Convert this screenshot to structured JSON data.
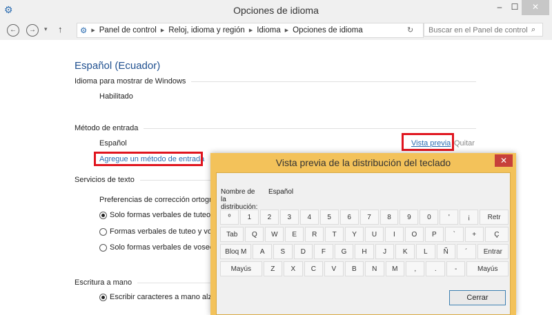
{
  "window": {
    "title": "Opciones de idioma",
    "minimize": "‒",
    "maximize": "☐",
    "close": "✕"
  },
  "nav": {
    "back": "←",
    "forward": "→",
    "dropdown": "▾",
    "up": "↑",
    "breadcrumb": [
      "Panel de control",
      "Reloj, idioma y región",
      "Idioma",
      "Opciones de idioma"
    ],
    "refresh": "↻",
    "search_placeholder": "Buscar en el Panel de control"
  },
  "main": {
    "language": "Español (Ecuador)",
    "display_section": "Idioma para mostrar de Windows",
    "display_status": "Habilitado",
    "input_section": "Método de entrada",
    "input_method": "Español",
    "preview_link": "Vista previa",
    "remove_link": "Quitar",
    "add_link": "Agregue un método de entrada",
    "text_section": "Servicios de texto",
    "spell_pref": "Preferencias de corrección ortográfica",
    "options": [
      "Solo formas verbales de tuteo",
      "Formas verbales de tuteo y voseo",
      "Solo formas verbales de voseo"
    ],
    "handwriting_section": "Escritura a mano",
    "handwriting_option": "Escribir caracteres a mano alzada"
  },
  "dialog": {
    "title": "Vista previa de la distribución del teclado",
    "close": "✕",
    "name_label": "Nombre de la distribución:",
    "name_value": "Español",
    "close_button": "Cerrar",
    "rows": [
      [
        "º",
        "1",
        "2",
        "3",
        "4",
        "5",
        "6",
        "7",
        "8",
        "9",
        "0",
        "'",
        "¡",
        "Retr"
      ],
      [
        "Tab",
        "Q",
        "W",
        "E",
        "R",
        "T",
        "Y",
        "U",
        "I",
        "O",
        "P",
        "`",
        "+",
        "Ç"
      ],
      [
        "Bloq M",
        "A",
        "S",
        "D",
        "F",
        "G",
        "H",
        "J",
        "K",
        "L",
        "Ñ",
        "´",
        "Entrar"
      ],
      [
        "Mayús",
        "Z",
        "X",
        "C",
        "V",
        "B",
        "N",
        "M",
        ",",
        ".",
        "-",
        "Mayús"
      ]
    ]
  }
}
